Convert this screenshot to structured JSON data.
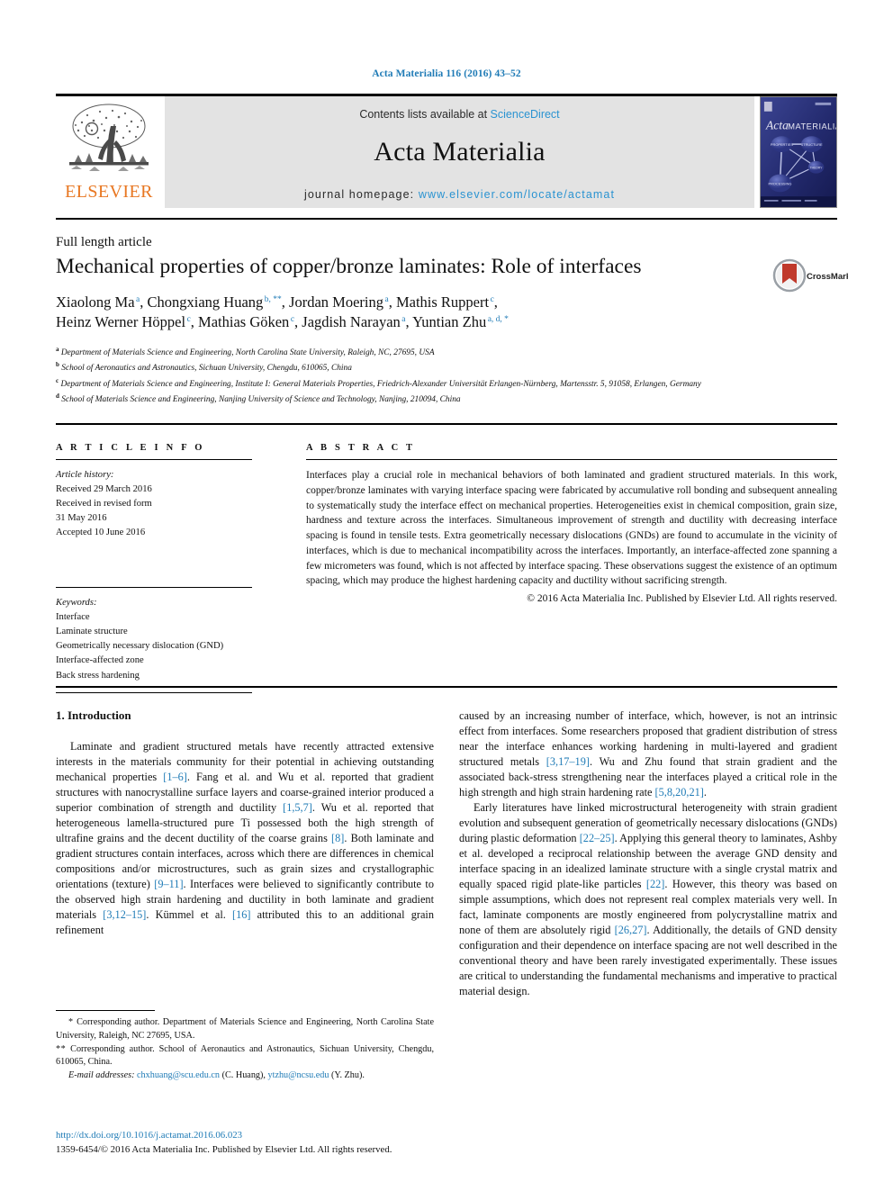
{
  "running_head": "Acta Materialia 116 (2016) 43–52",
  "masthead": {
    "contents_prefix": "Contents lists available at ",
    "sciencedirect": "ScienceDirect",
    "journal_title": "Acta Materialia",
    "homepage_prefix": "journal homepage: ",
    "homepage_url": "www.elsevier.com/locate/actamat",
    "publisher_name": "ELSEVIER",
    "cover_title_italic": "Acta",
    "cover_title_rest": "MATERIALIA",
    "cover_nodes": [
      "PROPERTIES",
      "STRUCTURE",
      "THEORY",
      "PROCESSING"
    ],
    "accent_orange": "#E87722",
    "link_blue": "#2a93d1",
    "band_gray": "#e3e3e3"
  },
  "article": {
    "type": "Full length article",
    "title": "Mechanical properties of copper/bronze laminates: Role of interfaces",
    "crossmark_label": "CrossMark",
    "authors": [
      {
        "name": "Xiaolong Ma",
        "sup": "a",
        "sep": ", "
      },
      {
        "name": "Chongxiang Huang",
        "sup": "b, **",
        "sep": ", "
      },
      {
        "name": "Jordan Moering",
        "sup": "a",
        "sep": ", "
      },
      {
        "name": "Mathis Ruppert",
        "sup": "c",
        "sep": ","
      },
      {
        "name": "Heinz Werner Höppel",
        "sup": "c",
        "sep": ", "
      },
      {
        "name": "Mathias Göken",
        "sup": "c",
        "sep": ", "
      },
      {
        "name": "Jagdish Narayan",
        "sup": "a",
        "sep": ", "
      },
      {
        "name": "Yuntian Zhu",
        "sup": "a, d, *",
        "sep": ""
      }
    ],
    "affiliations": [
      {
        "marker": "a",
        "text": "Department of Materials Science and Engineering, North Carolina State University, Raleigh, NC, 27695, USA"
      },
      {
        "marker": "b",
        "text": "School of Aeronautics and Astronautics, Sichuan University, Chengdu, 610065, China"
      },
      {
        "marker": "c",
        "text": "Department of Materials Science and Engineering, Institute I: General Materials Properties, Friedrich-Alexander Universität Erlangen-Nürnberg, Martensstr. 5, 91058, Erlangen, Germany"
      },
      {
        "marker": "d",
        "text": "School of Materials Science and Engineering, Nanjing University of Science and Technology, Nanjing, 210094, China"
      }
    ]
  },
  "article_info": {
    "label": "A R T I C L E   I N F O",
    "history_head": "Article history:",
    "history_lines": [
      "Received 29 March 2016",
      "Received in revised form",
      "31 May 2016",
      "Accepted 10 June 2016"
    ],
    "keywords_head": "Keywords:",
    "keywords": [
      "Interface",
      "Laminate structure",
      "Geometrically necessary dislocation (GND)",
      "Interface-affected zone",
      "Back stress hardening"
    ]
  },
  "abstract": {
    "label": "A B S T R A C T",
    "text": "Interfaces play a crucial role in mechanical behaviors of both laminated and gradient structured materials. In this work, copper/bronze laminates with varying interface spacing were fabricated by accumulative roll bonding and subsequent annealing to systematically study the interface effect on mechanical properties. Heterogeneities exist in chemical composition, grain size, hardness and texture across the interfaces. Simultaneous improvement of strength and ductility with decreasing interface spacing is found in tensile tests. Extra geometrically necessary dislocations (GNDs) are found to accumulate in the vicinity of interfaces, which is due to mechanical incompatibility across the interfaces. Importantly, an interface-affected zone spanning a few micrometers was found, which is not affected by interface spacing. These observations suggest the existence of an optimum spacing, which may produce the highest hardening capacity and ductility without sacrificing strength.",
    "copyright": "© 2016 Acta Materialia Inc. Published by Elsevier Ltd. All rights reserved."
  },
  "body": {
    "section_heading": "1. Introduction",
    "left_paragraph": "Laminate and gradient structured metals have recently attracted extensive interests in the materials community for their potential in achieving outstanding mechanical properties [1–6]. Fang et al. and Wu et al. reported that gradient structures with nanocrystalline surface layers and coarse-grained interior produced a superior combination of strength and ductility [1,5,7]. Wu et al. reported that heterogeneous lamella-structured pure Ti possessed both the high strength of ultrafine grains and the decent ductility of the coarse grains [8]. Both laminate and gradient structures contain interfaces, across which there are differences in chemical compositions and/or microstructures, such as grain sizes and crystallographic orientations (texture) [9–11]. Interfaces were believed to significantly contribute to the observed high strain hardening and ductility in both laminate and gradient materials [3,12–15]. Kümmel et al. [16] attributed this to an additional grain refinement",
    "right_paragraph_1": "caused by an increasing number of interface, which, however, is not an intrinsic effect from interfaces. Some researchers proposed that gradient distribution of stress near the interface enhances working hardening in multi-layered and gradient structured metals [3,17–19]. Wu and Zhu found that strain gradient and the associated back-stress strengthening near the interfaces played a critical role in the high strength and high strain hardening rate [5,8,20,21].",
    "right_paragraph_2": "Early literatures have linked microstructural heterogeneity with strain gradient evolution and subsequent generation of geometrically necessary dislocations (GNDs) during plastic deformation [22–25]. Applying this general theory to laminates, Ashby et al. developed a reciprocal relationship between the average GND density and interface spacing in an idealized laminate structure with a single crystal matrix and equally spaced rigid plate-like particles [22]. However, this theory was based on simple assumptions, which does not represent real complex materials very well. In fact, laminate components are mostly engineered from polycrystalline matrix and none of them are absolutely rigid [26,27]. Additionally, the details of GND density configuration and their dependence on interface spacing are not well described in the conventional theory and have been rarely investigated experimentally. These issues are critical to understanding the fundamental mechanisms and imperative to practical material design."
  },
  "footnotes": {
    "corresponding_1_marker": "*",
    "corresponding_1": "Corresponding author. Department of Materials Science and Engineering, North Carolina State University, Raleigh, NC 27695, USA.",
    "corresponding_2_marker": "**",
    "corresponding_2": "Corresponding author. School of Aeronautics and Astronautics, Sichuan University, Chengdu, 610065, China.",
    "email_label": "E-mail addresses:",
    "email_1": "chxhuang@scu.edu.cn",
    "email_1_owner": "(C. Huang),",
    "email_2": "ytzhu@ncsu.edu",
    "email_2_owner": "(Y. Zhu)."
  },
  "footer": {
    "doi": "http://dx.doi.org/10.1016/j.actamat.2016.06.023",
    "issn_line": "1359-6454/© 2016 Acta Materialia Inc. Published by Elsevier Ltd. All rights reserved."
  }
}
